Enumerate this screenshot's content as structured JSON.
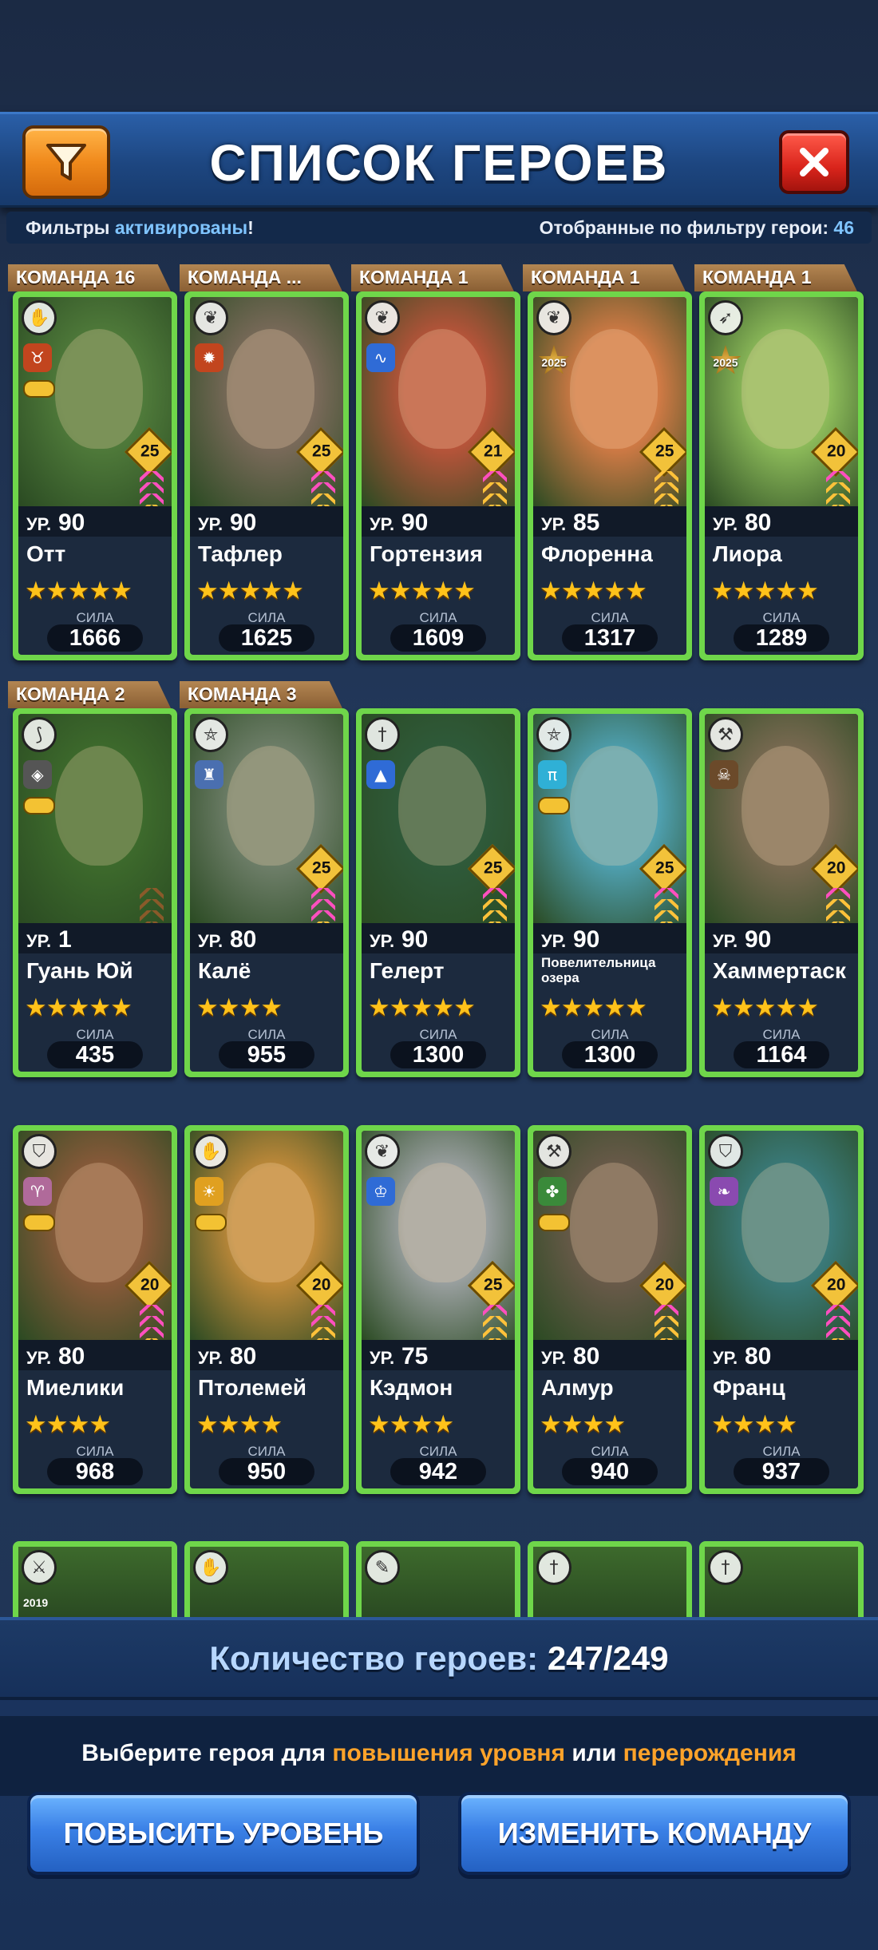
{
  "header": {
    "title": "СПИСОК ГЕРОЕВ",
    "filter_icon": "funnel-icon",
    "close_icon": "close-icon"
  },
  "filter_status": {
    "prefix": "Фильтры ",
    "state": "активированы",
    "suffix": "!",
    "count_label": "Отобранные по фильтру герои: ",
    "count_value": "46"
  },
  "power_label": "СИЛА",
  "level_prefix": "УР.",
  "colors": {
    "card_border": "#6fd64a",
    "accent_blue": "#7fc4ff",
    "accent_orange": "#ffa32a",
    "star": "#ffc21a"
  },
  "heroes": [
    {
      "team": "КОМАНДА 16",
      "name": "Отт",
      "level": "90",
      "stars": "★★★★★",
      "emblem": "25",
      "power": "1666",
      "class_icon": "hand-icon",
      "element_color": "#c2451e",
      "element_icon": "bull-icon",
      "mask": true,
      "year": "",
      "bg": "#4f7a3a",
      "chev": [
        "#ff4fbf",
        "#ff4fbf",
        "#ff4fbf",
        "#ffc23a"
      ]
    },
    {
      "team": "КОМАНДА ...",
      "name": "Тафлер",
      "level": "90",
      "stars": "★★★★★",
      "emblem": "25",
      "power": "1625",
      "class_icon": "leaf-icon",
      "element_color": "#c2451e",
      "element_icon": "tiger-icon",
      "mask": false,
      "year": "",
      "bg": "#7a6a5a",
      "chev": [
        "#ff4fbf",
        "#ff4fbf",
        "#ffc23a",
        "#ffc23a"
      ]
    },
    {
      "team": "КОМАНДА 1",
      "name": "Гортензия",
      "level": "90",
      "stars": "★★★★★",
      "emblem": "21",
      "power": "1609",
      "class_icon": "leaf-icon",
      "element_color": "#2f6bd6",
      "element_icon": "snake-icon",
      "mask": false,
      "year": "",
      "bg": "#b8543a",
      "chev": [
        "#ff4fbf",
        "#ffc23a",
        "#ffc23a",
        "#ffc23a"
      ]
    },
    {
      "team": "КОМАНДА 1",
      "name": "Флоренна",
      "level": "85",
      "stars": "★★★★★",
      "emblem": "25",
      "power": "1317",
      "class_icon": "leaf-icon",
      "element_color": "#b58a2a",
      "element_icon": "star-icon",
      "mask": false,
      "year": "2025",
      "bg": "#d07a45",
      "chev": [
        "#ffc23a",
        "#ffc23a",
        "#ffc23a",
        "#ffc23a"
      ]
    },
    {
      "team": "КОМАНДА 1",
      "name": "Лиора",
      "level": "80",
      "stars": "★★★★★",
      "emblem": "20",
      "power": "1289",
      "class_icon": "bow-icon",
      "element_color": "#b58a2a",
      "element_icon": "star-icon",
      "mask": false,
      "year": "2025",
      "bg": "#8dbb5a",
      "chev": [
        "#ff4fbf",
        "#ffc23a",
        "#ffc23a",
        "#ffc23a"
      ]
    },
    {
      "team": "КОМАНДА 2",
      "name": "Гуань Юй",
      "level": "1",
      "stars": "★★★★★",
      "emblem": "",
      "power": "435",
      "class_icon": "claw-icon",
      "element_color": "#555",
      "element_icon": "mask-icon",
      "mask": true,
      "year": "",
      "bg": "#3d6a2c",
      "chev": [
        "#8a5a2a",
        "#8a5a2a",
        "#8a5a2a",
        "#8a5a2a"
      ]
    },
    {
      "team": "КОМАНДА 3",
      "name": "Калё",
      "level": "80",
      "stars": "★★★★",
      "emblem": "25",
      "power": "955",
      "class_icon": "pentagram-icon",
      "element_color": "#4a6fb0",
      "element_icon": "castle-icon",
      "mask": false,
      "year": "",
      "bg": "#6f7f6a",
      "chev": [
        "#ff4fbf",
        "#ff4fbf",
        "#ff4fbf",
        "#ffc23a"
      ]
    },
    {
      "team": "",
      "name": "Гелерт",
      "level": "90",
      "stars": "★★★★★",
      "emblem": "25",
      "power": "1300",
      "class_icon": "sword-icon",
      "element_color": "#2f6bd6",
      "element_icon": "triangle-icon",
      "mask": false,
      "year": "",
      "bg": "#2f5a3a",
      "chev": [
        "#ff4fbf",
        "#ffc23a",
        "#ffc23a",
        "#ffc23a"
      ]
    },
    {
      "team": "",
      "name": "Повелительница озера",
      "level": "90",
      "stars": "★★★★★",
      "emblem": "25",
      "power": "1300",
      "class_icon": "pentagram-icon",
      "element_color": "#2fb0d6",
      "element_icon": "pi-icon",
      "mask": true,
      "year": "",
      "bg": "#4fa0b0",
      "chev": [
        "#ff4fbf",
        "#ffc23a",
        "#ffc23a",
        "#ffc23a"
      ]
    },
    {
      "team": "",
      "name": "Хаммертаск",
      "level": "90",
      "stars": "★★★★★",
      "emblem": "20",
      "power": "1164",
      "class_icon": "axe-icon",
      "element_color": "#6b4a2a",
      "element_icon": "skull-icon",
      "mask": false,
      "year": "",
      "bg": "#7a6a52",
      "chev": [
        "#ff4fbf",
        "#ffc23a",
        "#ffc23a",
        "#ffc23a"
      ]
    },
    {
      "team": "",
      "name": "Миелики",
      "level": "80",
      "stars": "★★★★",
      "emblem": "20",
      "power": "968",
      "class_icon": "shield-icon",
      "element_color": "#b06a9a",
      "element_icon": "deer-icon",
      "mask": true,
      "year": "",
      "bg": "#8a5a3a",
      "chev": [
        "#ff4fbf",
        "#ff4fbf",
        "#ff4fbf",
        "#ffc23a"
      ]
    },
    {
      "team": "",
      "name": "Птолемей",
      "level": "80",
      "stars": "★★★★",
      "emblem": "20",
      "power": "950",
      "class_icon": "hand-icon",
      "element_color": "#e0a020",
      "element_icon": "sun-icon",
      "mask": true,
      "year": "",
      "bg": "#c08a3a",
      "chev": [
        "#ff4fbf",
        "#ff4fbf",
        "#ffc23a",
        "#ffc23a"
      ]
    },
    {
      "team": "",
      "name": "Кэдмон",
      "level": "75",
      "stars": "★★★★",
      "emblem": "25",
      "power": "942",
      "class_icon": "leaf-icon",
      "element_color": "#2f6bd6",
      "element_icon": "trophy-icon",
      "mask": false,
      "year": "",
      "bg": "#9aa0a0",
      "chev": [
        "#ff4fbf",
        "#ffc23a",
        "#ffc23a",
        "#ffc23a"
      ]
    },
    {
      "team": "",
      "name": "Алмур",
      "level": "80",
      "stars": "★★★★",
      "emblem": "20",
      "power": "940",
      "class_icon": "axe-icon",
      "element_color": "#3a8a3a",
      "element_icon": "paw-icon",
      "mask": true,
      "year": "",
      "bg": "#6a5a4a",
      "chev": [
        "#ff4fbf",
        "#ffc23a",
        "#ffc23a",
        "#ffc23a"
      ]
    },
    {
      "team": "",
      "name": "Франц",
      "level": "80",
      "stars": "★★★★",
      "emblem": "20",
      "power": "937",
      "class_icon": "shield-icon",
      "element_color": "#8a4ab0",
      "element_icon": "bird-icon",
      "mask": false,
      "year": "",
      "bg": "#3a7a7a",
      "chev": [
        "#ff4fbf",
        "#ff4fbf",
        "#ff4fbf",
        "#ffc23a"
      ]
    }
  ],
  "partial_row_icons": [
    "swords-icon",
    "hand-icon",
    "feather-icon",
    "sword-icon",
    "sword-icon"
  ],
  "partial_row_year": "2019",
  "bottom": {
    "count_label": "Количество героев: ",
    "count_value": "247/249",
    "hint_prefix": "Выберите героя для ",
    "hint_level": "повышения уровня",
    "hint_mid": " или ",
    "hint_rebirth": "перерождения",
    "btn_level_up": "ПОВЫСИТЬ УРОВЕНЬ",
    "btn_change_team": "ИЗМЕНИТЬ КОМАНДУ"
  }
}
